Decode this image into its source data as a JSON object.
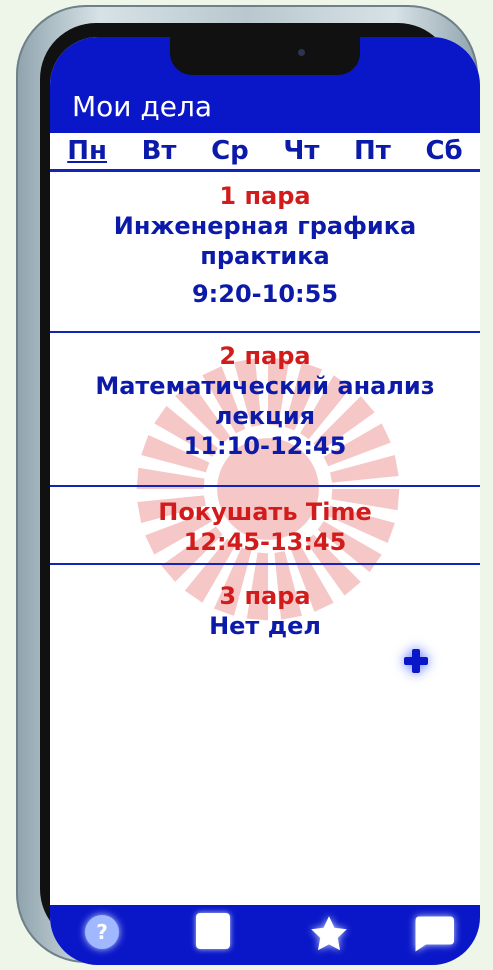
{
  "header": {
    "title": "Мои дела"
  },
  "days": [
    "Пн",
    "Вт",
    "Ср",
    "Чт",
    "Пт",
    "Сб"
  ],
  "active_day": "Пн",
  "slots": [
    {
      "label": "1 пара",
      "lines": [
        "Инженерная графика",
        "практика",
        "9:20-10:55"
      ]
    },
    {
      "label": "2 пара",
      "lines": [
        "Математический анализ",
        "лекция",
        "11:10-12:45"
      ]
    },
    {
      "label": "Покушать Time",
      "lines": [
        "12:45-13:45"
      ]
    },
    {
      "label": "3 пара",
      "lines": [
        "Нет дел"
      ]
    }
  ],
  "icons": {
    "add": "plus-icon",
    "help": "question-icon",
    "square": "square-icon",
    "favorite": "star-icon",
    "chat": "chat-bubble-icon"
  },
  "help_glyph": "?",
  "colors": {
    "brand_blue": "#0a17c8",
    "text_blue": "#0b1aa9",
    "label_red": "#d21c1c",
    "watermark_red": "#e23b3b"
  }
}
